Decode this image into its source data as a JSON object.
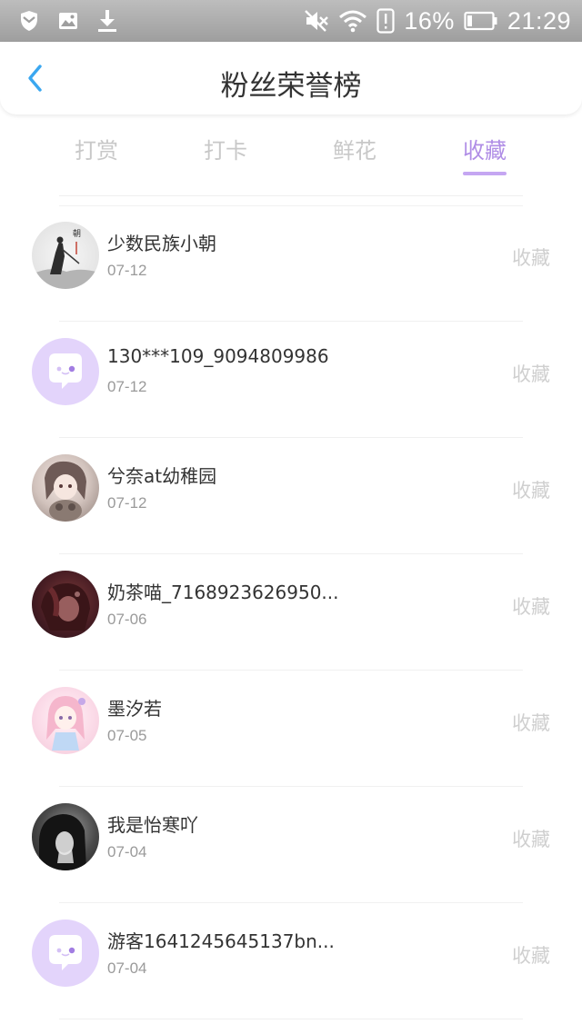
{
  "status_bar": {
    "battery": "16%",
    "time": "21:29"
  },
  "header": {
    "title": "粉丝荣誉榜"
  },
  "tabs": [
    {
      "label": "打赏",
      "active": false
    },
    {
      "label": "打卡",
      "active": false
    },
    {
      "label": "鲜花",
      "active": false
    },
    {
      "label": "收藏",
      "active": true
    }
  ],
  "colors": {
    "accent": "#b08ee6",
    "accent_underline": "#c5a6f2",
    "inactive_tab": "#c8c8c8",
    "action_text": "#cfcfcf",
    "default_avatar": "#e3d4fb"
  },
  "fans": [
    {
      "name": "少数民族小朝",
      "date": "07-12",
      "action": "收藏",
      "avatar": "ink-painting-avatar"
    },
    {
      "name": "130***109_9094809986",
      "date": "07-12",
      "action": "收藏",
      "avatar": "default-chat-avatar"
    },
    {
      "name": "兮奈at幼稚园",
      "date": "07-12",
      "action": "收藏",
      "avatar": "anime-avatar"
    },
    {
      "name": "奶茶喵_7168923626950...",
      "date": "07-06",
      "action": "收藏",
      "avatar": "dark-avatar"
    },
    {
      "name": "墨汐若",
      "date": "07-05",
      "action": "收藏",
      "avatar": "pink-anime-avatar"
    },
    {
      "name": "我是怡寒吖",
      "date": "07-04",
      "action": "收藏",
      "avatar": "bw-photo-avatar"
    },
    {
      "name": "游客1641245645137bn...",
      "date": "07-04",
      "action": "收藏",
      "avatar": "default-chat-avatar"
    }
  ]
}
